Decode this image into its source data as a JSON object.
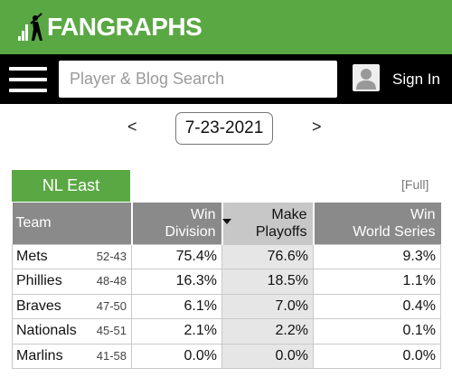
{
  "header": {
    "brand": "FANGRAPHS",
    "search_placeholder": "Player & Blog Search",
    "sign_in_label": "Sign In",
    "brand_color": "#5aa843"
  },
  "date_nav": {
    "prev_label": "<",
    "date": "7-23-2021",
    "next_label": ">"
  },
  "division": {
    "tab_label": "NL East",
    "full_link": "[Full]"
  },
  "table": {
    "headers": {
      "team": "Team",
      "win_division_line1": "Win",
      "win_division_line2": "Division",
      "make_playoffs_line1": "Make",
      "make_playoffs_line2": "Playoffs",
      "win_ws_line1": "Win",
      "win_ws_line2": "World Series"
    },
    "rows": [
      {
        "team": "Mets",
        "record": "52-43",
        "win_division": "75.4%",
        "make_playoffs": "76.6%",
        "win_ws": "9.3%"
      },
      {
        "team": "Phillies",
        "record": "48-48",
        "win_division": "16.3%",
        "make_playoffs": "18.5%",
        "win_ws": "1.1%"
      },
      {
        "team": "Braves",
        "record": "47-50",
        "win_division": "6.1%",
        "make_playoffs": "7.0%",
        "win_ws": "0.4%"
      },
      {
        "team": "Nationals",
        "record": "45-51",
        "win_division": "2.1%",
        "make_playoffs": "2.2%",
        "win_ws": "0.1%"
      },
      {
        "team": "Marlins",
        "record": "41-58",
        "win_division": "0.0%",
        "make_playoffs": "0.0%",
        "win_ws": "0.0%"
      }
    ]
  }
}
